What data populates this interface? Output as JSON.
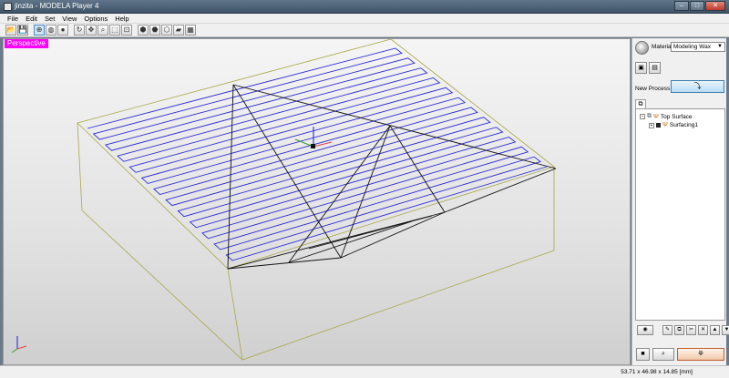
{
  "window": {
    "title": "jinzita - MODELA Player 4"
  },
  "menu": [
    "File",
    "Edit",
    "Set",
    "View",
    "Options",
    "Help"
  ],
  "toolbar": [
    {
      "name": "open-icon",
      "glyph": "📂"
    },
    {
      "name": "save-icon",
      "glyph": "💾"
    },
    {
      "sep": true
    },
    {
      "name": "rotate-view-icon",
      "glyph": "⊕",
      "active": true
    },
    {
      "name": "wire-sphere-icon",
      "glyph": "◍"
    },
    {
      "name": "shaded-sphere-icon",
      "glyph": "●"
    },
    {
      "sep": true
    },
    {
      "name": "rotate-icon",
      "glyph": "↻"
    },
    {
      "name": "pan-icon",
      "glyph": "✥"
    },
    {
      "name": "zoom-icon",
      "glyph": "⌕"
    },
    {
      "name": "zoom-window-icon",
      "glyph": "⬚"
    },
    {
      "name": "fit-icon",
      "glyph": "⊡"
    },
    {
      "sep": true
    },
    {
      "name": "view-iso-icon",
      "glyph": "⬢"
    },
    {
      "name": "view-top-icon",
      "glyph": "⬣"
    },
    {
      "name": "view-front-icon",
      "glyph": "⬡"
    },
    {
      "name": "view-side-icon",
      "glyph": "▰"
    },
    {
      "name": "view-grid-icon",
      "glyph": "▦"
    }
  ],
  "viewport": {
    "view_name": "Perspective"
  },
  "panel": {
    "material_label": "Material",
    "material_value": "Modeling Wax",
    "new_process_label": "New Process",
    "tree": {
      "root": "Top Surface",
      "child": "Surfacing1"
    }
  },
  "status": {
    "dimensions": "53.71 x 46.98 x 14.85 [mm]"
  },
  "colors": {
    "toolpath": "#2b2bd9",
    "box": "#a8a84a",
    "wire": "#111111",
    "view_label_bg": "#ff00ff"
  }
}
